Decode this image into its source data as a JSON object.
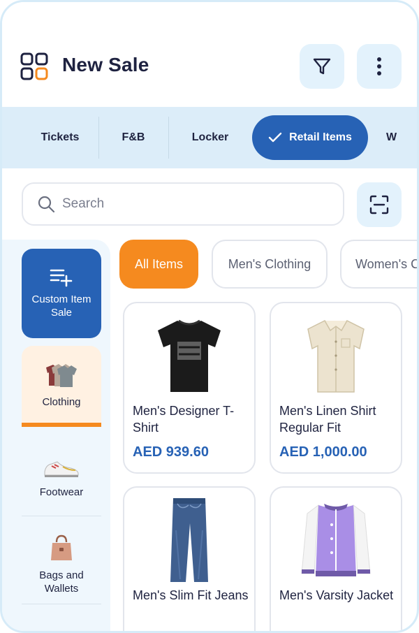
{
  "header": {
    "title": "New Sale",
    "icons": {
      "app": "grid-apps-icon",
      "filter": "filter-funnel-icon",
      "more": "more-vertical-icon"
    }
  },
  "tabs": [
    {
      "label": "Tickets",
      "active": false
    },
    {
      "label": "F&B",
      "active": false
    },
    {
      "label": "Locker",
      "active": false
    },
    {
      "label": "Retail Items",
      "active": true
    },
    {
      "label": "W",
      "active": false
    }
  ],
  "search": {
    "placeholder": "Search",
    "value": ""
  },
  "sidebar": {
    "custom_sale_label": "Custom Item Sale",
    "categories": [
      {
        "label": "Clothing",
        "selected": true,
        "icon": "clothing-stack-icon"
      },
      {
        "label": "Footwear",
        "selected": false,
        "icon": "sneaker-icon"
      },
      {
        "label": "Bags and Wallets",
        "selected": false,
        "icon": "handbag-icon"
      }
    ]
  },
  "chips": [
    {
      "label": "All Items",
      "active": true
    },
    {
      "label": "Men's Clothing",
      "active": false
    },
    {
      "label": "Women's C",
      "active": false
    }
  ],
  "products": [
    {
      "name": "Men's Designer T-Shirt",
      "price": "AED 939.60",
      "image": "black-tshirt"
    },
    {
      "name": "Men's Linen Shirt Regular Fit",
      "price": "AED 1,000.00",
      "image": "linen-shirt"
    },
    {
      "name": "Men's Slim Fit Jeans",
      "price": "",
      "image": "blue-jeans"
    },
    {
      "name": "Men's Varsity Jacket",
      "price": "",
      "image": "varsity-jacket"
    }
  ],
  "colors": {
    "primary": "#2762b5",
    "accent": "#f58a1f",
    "tab_bg": "#dcedf9",
    "icon_btn_bg": "#e3f2fc",
    "frame": "#d6ebf8"
  }
}
